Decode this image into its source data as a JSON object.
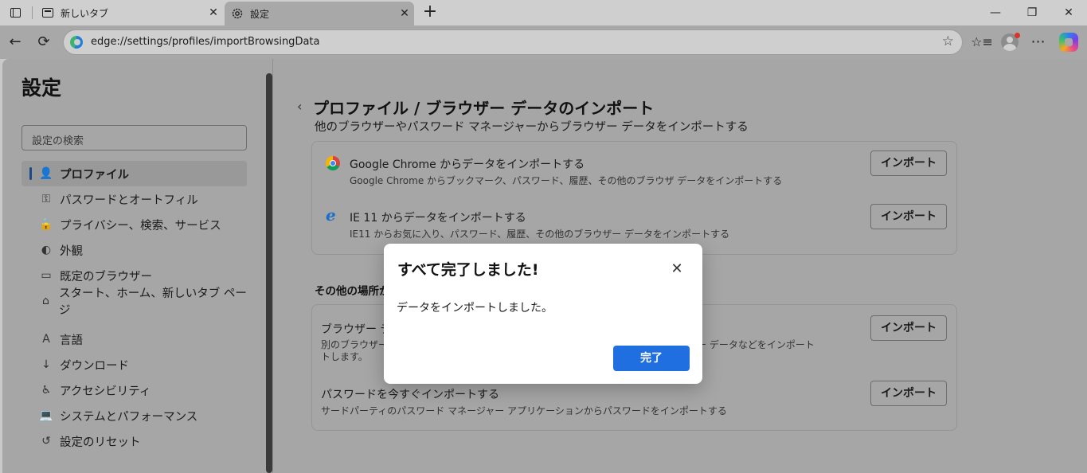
{
  "browser": {
    "tabs": [
      {
        "label": "新しいタブ",
        "icon": "new-tab-page-icon"
      },
      {
        "label": "設定",
        "icon": "gear-icon"
      }
    ],
    "close_glyph": "✕",
    "new_tab_glyph": "+",
    "window": {
      "minimize": "—",
      "maximize": "❐",
      "close": "✕"
    },
    "url": "edge://settings/profiles/importBrowsingData",
    "nav": {
      "back": "←",
      "reload": "⟳",
      "star": "☆",
      "favorites": "☆≡",
      "more": "⋯"
    }
  },
  "sidebar": {
    "title": "設定",
    "search_placeholder": "設定の検索",
    "items": [
      {
        "label": "プロファイル",
        "icon": "👤",
        "active": true
      },
      {
        "label": "パスワードとオートフィル",
        "icon": "⚿"
      },
      {
        "label": "プライバシー、検索、サービス",
        "icon": "🔒"
      },
      {
        "label": "外観",
        "icon": "◐"
      },
      {
        "label": "既定のブラウザー",
        "icon": "▭"
      },
      {
        "label": "スタート、ホーム、新しいタブ ページ",
        "icon": "⌂"
      },
      {
        "label": "言語",
        "icon": "A"
      },
      {
        "label": "ダウンロード",
        "icon": "↓"
      },
      {
        "label": "アクセシビリティ",
        "icon": "♿"
      },
      {
        "label": "システムとパフォーマンス",
        "icon": "💻"
      },
      {
        "label": "設定のリセット",
        "icon": "↺"
      }
    ]
  },
  "main": {
    "back_glyph": "‹",
    "title": "プロファイル / ブラウザー データのインポート",
    "subtitle": "他のブラウザーやパスワード マネージャーからブラウザー データをインポートする",
    "rows": [
      {
        "title": "Google Chrome からデータをインポートする",
        "desc": "Google Chrome からブックマーク、パスワード、履歴、その他のブラウザ データをインポートする",
        "button": "インポート"
      },
      {
        "title": "IE 11 からデータをインポートする",
        "desc": "IE11 からお気に入り、パスワード、履歴、その他のブラウザー データをインポートする",
        "button": "インポート"
      }
    ],
    "other_heading": "その他の場所から",
    "other_rows": [
      {
        "title": "ブラウザー データを今すぐインポートする",
        "desc_line1": "別のブラウザーまたは HTML ファイルからお気に入り、パスワード、その他のブラウザー データなどをインポート",
        "desc_line2": "トします。",
        "button": "インポート"
      },
      {
        "title": "パスワードを今すぐインポートする",
        "desc": "サードパーティのパスワード マネージャー アプリケーションからパスワードをインポートする",
        "button": "インポート"
      }
    ]
  },
  "dialog": {
    "title": "すべて完了しました!",
    "close_glyph": "✕",
    "message": "データをインポートしました。",
    "done_button": "完了"
  },
  "ie_glyph": "e"
}
